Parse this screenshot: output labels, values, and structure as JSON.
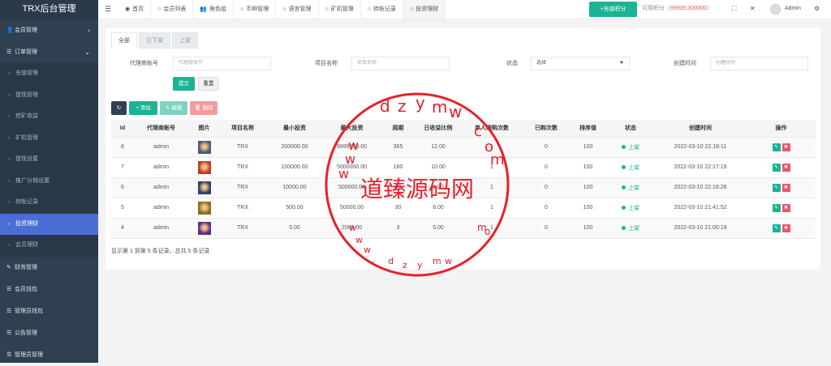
{
  "app": {
    "title": "TRX后台管理"
  },
  "sidebar": {
    "items": [
      {
        "label": "会员管理",
        "icon": "user-icon",
        "chevron": "‹"
      },
      {
        "label": "订单管理",
        "icon": "list-icon",
        "chevron": "⌄"
      }
    ],
    "subitems": [
      "充值管理",
      "提现管理",
      "挖矿收益",
      "矿机管理",
      "提现设置",
      "推广分佣设置",
      "转账记录",
      "投资理财",
      "会员理财"
    ],
    "active_sub": 7,
    "bottom_items": [
      {
        "label": "财务管理",
        "icon": "edit-icon"
      },
      {
        "label": "会员钱包",
        "icon": "list-icon"
      },
      {
        "label": "管理员钱包",
        "icon": "list-icon"
      },
      {
        "label": "公告管理",
        "icon": "list-icon"
      },
      {
        "label": "管理员管理",
        "icon": "list-icon"
      }
    ]
  },
  "topbar": {
    "tabs": [
      {
        "label": "首页",
        "icon": "dashboard-icon"
      },
      {
        "label": "会员列表",
        "icon": "circle-icon"
      },
      {
        "label": "角色组",
        "icon": "users-icon"
      },
      {
        "label": "币种管理",
        "icon": "circle-icon"
      },
      {
        "label": "语言管理",
        "icon": "circle-icon"
      },
      {
        "label": "矿机管理",
        "icon": "circle-icon"
      },
      {
        "label": "转账记录",
        "icon": "circle-icon"
      },
      {
        "label": "投资理财",
        "icon": "circle-icon"
      }
    ],
    "active_tab": 7,
    "recharge_label": "+充值积分",
    "credit_label": "可用积分（",
    "credit_amount": "99935.300000",
    "credit_suffix": "）",
    "user": "Admin"
  },
  "filters": {
    "subtabs": [
      "全部",
      "已下架",
      "上架"
    ],
    "agent_label": "代理商账号",
    "agent_placeholder": "代理商账号",
    "project_label": "项目名称",
    "project_placeholder": "项目名称",
    "status_label": "状态",
    "status_value": "选择",
    "created_label": "创建时间",
    "created_placeholder": "创建时间",
    "submit_label": "提交",
    "reset_label": "重置"
  },
  "toolbar": {
    "add_label": "添加",
    "edit_label": "编辑",
    "delete_label": "删除"
  },
  "table": {
    "headers": [
      "Id",
      "代理商账号",
      "图片",
      "项目名称",
      "最小投资",
      "最大投资",
      "周期",
      "日收益比例",
      "单人限购次数",
      "已购次数",
      "排序值",
      "状态",
      "创建时间",
      "操作"
    ],
    "rows": [
      {
        "id": "8",
        "agent": "admin",
        "thumb": "#4a5a7a",
        "name": "TRX",
        "min": "200000.00",
        "max": "9999999.00",
        "period": "365",
        "rate": "12.00",
        "limit": "1",
        "bought": "0",
        "sort": "100",
        "status": "上架",
        "created": "2022-03-10 22:18:11"
      },
      {
        "id": "7",
        "agent": "admin",
        "thumb": "#c0392b",
        "name": "TRX",
        "min": "100000.00",
        "max": "5000000.00",
        "period": "180",
        "rate": "10.00",
        "limit": "1",
        "bought": "0",
        "sort": "100",
        "status": "上架",
        "created": "2022-03-10 22:17:19"
      },
      {
        "id": "6",
        "agent": "admin",
        "thumb": "#2c3e70",
        "name": "TRX",
        "min": "10000.00",
        "max": "500000.00",
        "period": "90",
        "rate": "8.00",
        "limit": "1",
        "bought": "0",
        "sort": "100",
        "status": "上架",
        "created": "2022-03-10 22:16:26"
      },
      {
        "id": "5",
        "agent": "admin",
        "thumb": "#8e6b1f",
        "name": "TRX",
        "min": "500.00",
        "max": "50000.00",
        "period": "30",
        "rate": "6.00",
        "limit": "1",
        "bought": "0",
        "sort": "100",
        "status": "上架",
        "created": "2022-03-10 21:41:52"
      },
      {
        "id": "4",
        "agent": "admin",
        "thumb": "#5b2c8a",
        "name": "TRX",
        "min": "5.00",
        "max": "2000.00",
        "period": "3",
        "rate": "5.00",
        "limit": "1",
        "bought": "0",
        "sort": "100",
        "status": "上架",
        "created": "2022-03-10 21:00:19"
      }
    ]
  },
  "footer": {
    "info": "显示第 1 到第 5 条记录，总共 5 条记录"
  },
  "watermark": {
    "title": "道臻源码网",
    "letters": [
      "d",
      "z",
      "y",
      "m",
      "w",
      ".",
      "c",
      "o",
      "m",
      "w",
      "w",
      "w"
    ]
  }
}
